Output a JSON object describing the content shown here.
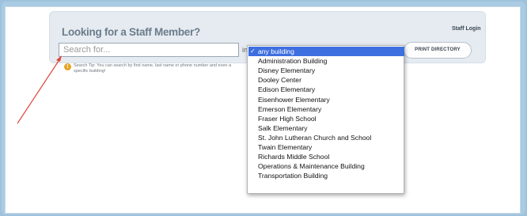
{
  "panel": {
    "title": "Looking for a Staff Member?",
    "staff_login": "Staff Login",
    "search_placeholder": "Search for...",
    "building_prefix": "in",
    "tip_text": "Search Tip: You can search by first name, last name or phone number and even a specific building!",
    "print_button": "PRINT DIRECTORY"
  },
  "dropdown": {
    "selected_index": 0,
    "check_glyph": "✓",
    "options": [
      "any building",
      "Administration Building",
      "Disney Elementary",
      "Dooley Center",
      "Edison Elementary",
      "Eisenhower Elementary",
      "Emerson Elementary",
      "Fraser High School",
      "Salk Elementary",
      "St. John Lutheran Church and School",
      "Twain Elementary",
      "Richards Middle School",
      "Operations & Maintenance Building",
      "Transportation Building"
    ]
  },
  "colors": {
    "selected_bg": "#3d6fe0",
    "arrow": "#e0453a",
    "tip_icon": "#e5a526"
  },
  "icons": {
    "tip": "lightbulb-icon",
    "check": "checkmark-icon",
    "annotation": "arrow-annotation"
  }
}
